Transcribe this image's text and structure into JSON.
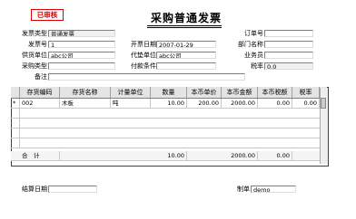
{
  "stamp": "已审核",
  "title": "采购普通发票",
  "fields": {
    "invoice_type": {
      "label": "发票类型",
      "value": "普通发票"
    },
    "invoice_no": {
      "label": "发票号",
      "value": "1"
    },
    "invoice_date": {
      "label": "开票日期",
      "value": "2007-01-29"
    },
    "supplier": {
      "label": "供货单位",
      "value": "abc公司"
    },
    "agent_unit": {
      "label": "代垫单位",
      "value": "abc公司"
    },
    "purchase_type": {
      "label": "采购类型",
      "value": ""
    },
    "payment_terms": {
      "label": "付款条件",
      "value": ""
    },
    "note": {
      "label": "备注",
      "value": ""
    },
    "order_no": {
      "label": "订单号",
      "value": ""
    },
    "department": {
      "label": "部门名称",
      "value": ""
    },
    "salesperson": {
      "label": "业务员",
      "value": ""
    },
    "tax_rate": {
      "label": "税率",
      "value": "0.0"
    },
    "settle_date": {
      "label": "结算日期",
      "value": ""
    },
    "maker": {
      "label": "制单",
      "value": "demo"
    }
  },
  "table": {
    "columns": [
      "存货编码",
      "存货名称",
      "计量单位",
      "数量",
      "本币单价",
      "本币金额",
      "本币税额",
      "税率"
    ],
    "rows": [
      {
        "marker": "*",
        "code": "002",
        "name": "木板",
        "unit": "吨",
        "qty": "10.00",
        "price": "200.00",
        "amount": "2000.00",
        "tax": "0.00",
        "rate": "0.00"
      }
    ],
    "total": {
      "label": "合　计",
      "qty": "10.00",
      "amount": "2000.00",
      "tax": "0.00"
    }
  }
}
